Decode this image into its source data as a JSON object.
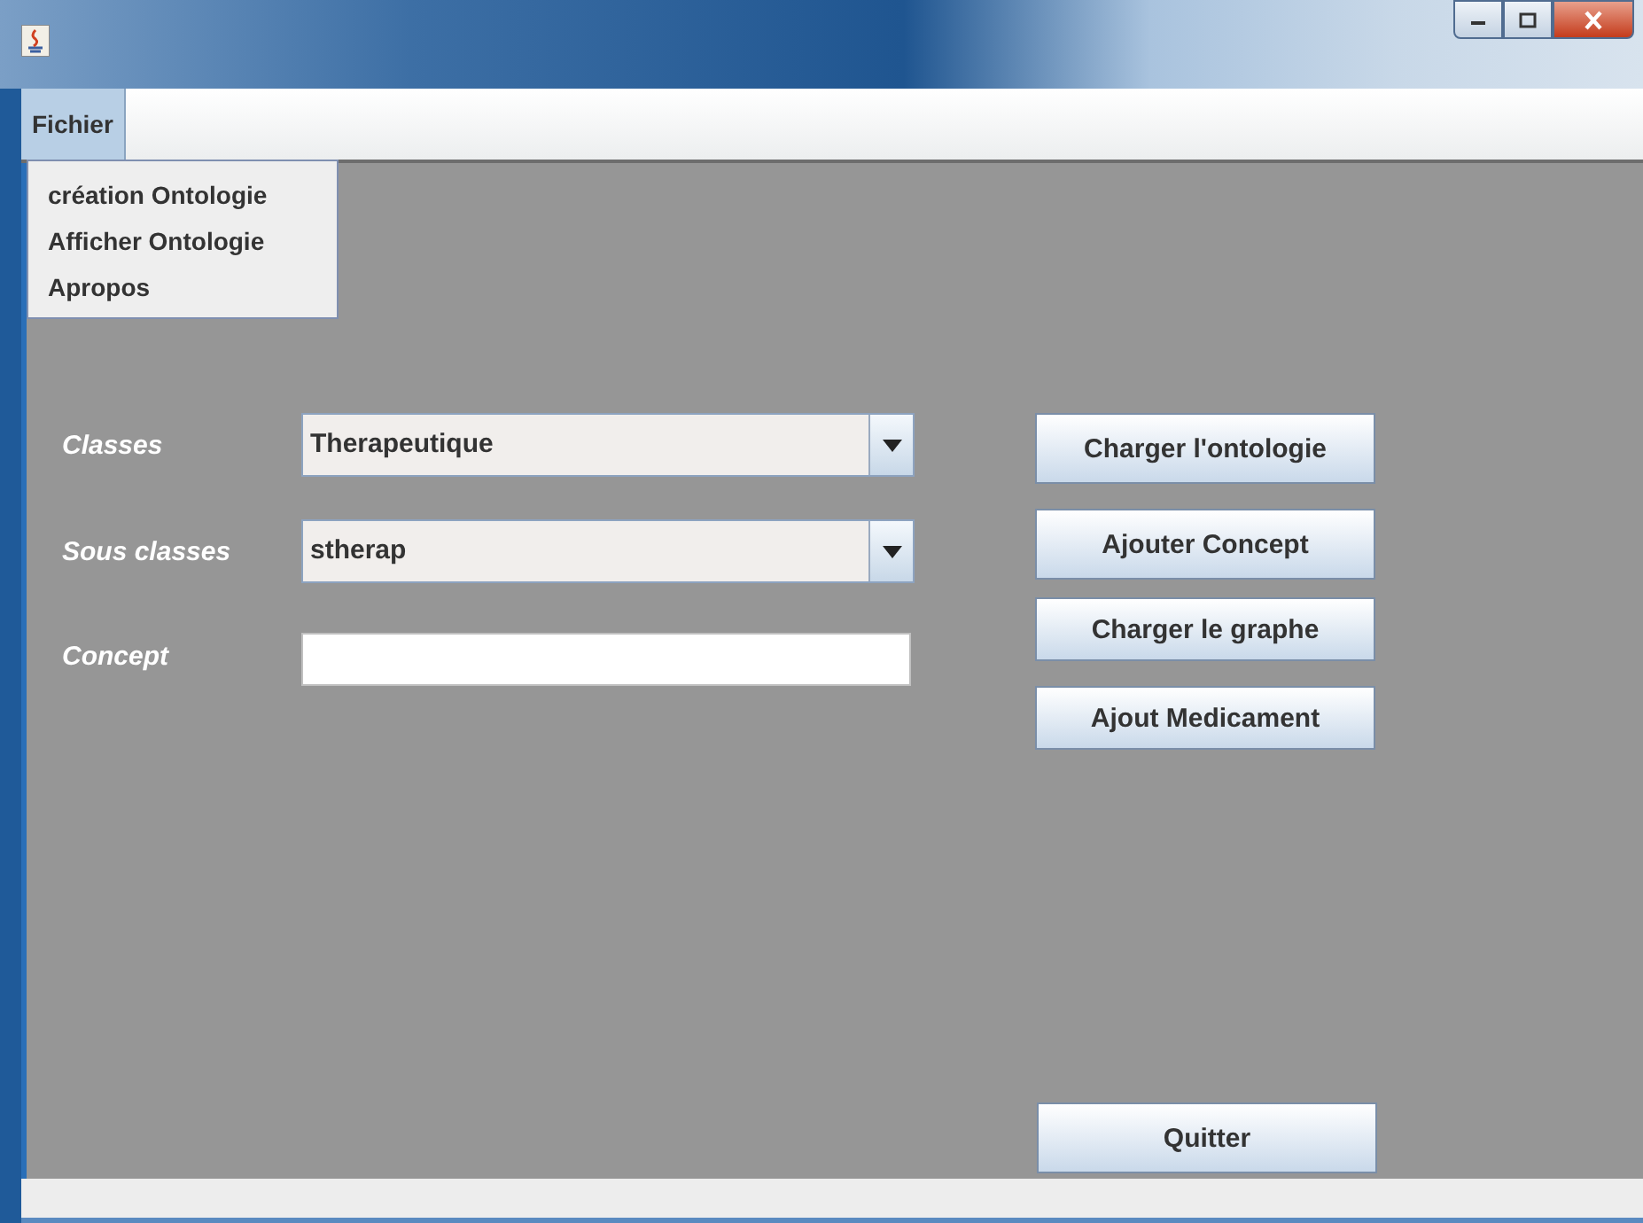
{
  "menubar": [
    {
      "label": "Fichier",
      "selected": true
    }
  ],
  "menu_items": [
    "création Ontologie",
    "Afficher Ontologie",
    "Apropos"
  ],
  "form": [
    {
      "label": "Classes",
      "kind": "combo",
      "value": "Therapeutique"
    },
    {
      "label": "Sous classes",
      "kind": "combo",
      "value": "stherap"
    },
    {
      "label": "Concept",
      "kind": "text"
    }
  ],
  "buttons": [
    "Charger l'ontologie",
    "Ajouter Concept",
    "Charger le graphe",
    "Ajout Medicament"
  ],
  "quit_button": "Quitter"
}
